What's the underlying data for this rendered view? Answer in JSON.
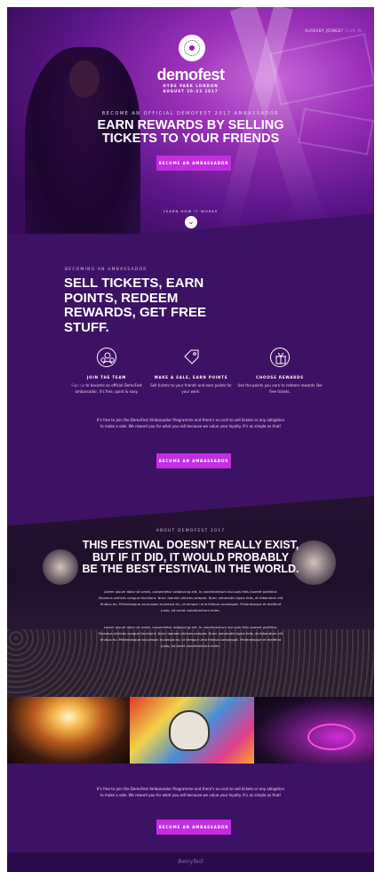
{
  "hero": {
    "signin_prefix": "ALREADY JOINED?",
    "signin_link": "SIGN IN",
    "brand": "demofest",
    "venue_line1": "HYDE PARK LONDON",
    "venue_line2": "AUGUST 20-23 2017",
    "eyebrow": "BECOME AN OFFICIAL DEMOFEST 2017 AMBASSADOR",
    "title_line1": "EARN REWARDS BY SELLING",
    "title_line2": "TICKETS TO YOUR FRIENDS",
    "cta": "BECOME AN AMBASSADOR",
    "learn": "LEARN HOW IT WORKS",
    "chevron": "⌄"
  },
  "ambassador": {
    "eyebrow": "BECOMING AN AMBASSADOR",
    "title": "SELL TICKETS, EARN POINTS, REDEEM REWARDS, GET FREE STUFF.",
    "features": [
      {
        "icon": "team-icon",
        "title": "JOIN THE TEAM",
        "highlight": "Sign up",
        "desc": " to become an official DemoFest ambassador, it's free, quick & easy."
      },
      {
        "icon": "tag-icon",
        "title": "MAKE A SALE, EARN POINTS",
        "highlight": "",
        "desc": "Sell tickets to your friends and earn points for your work."
      },
      {
        "icon": "gift-icon",
        "title": "CHOOSE REWARDS",
        "highlight": "",
        "desc": "Use the points you earn to redeem rewards like free tickets."
      }
    ],
    "paragraph": "It's free to join the DemoFest Ambassador Programme and there's no cost to sell tickets or any obligation to make a sale. We reward you for what you sell because we value your loyalty. It's as simple as that!",
    "cta": "BECOME AN AMBASSADOR"
  },
  "about": {
    "eyebrow": "ABOUT DEMOFEST 2017",
    "title_line1": "THIS FESTIVAL DOESN'T REALLY EXIST,",
    "title_line2": "BUT IF IT DID, IT WOULD PROBABLY",
    "title_line3": "BE THE BEST FESTIVAL IN THE WORLD.",
    "p1": "Lorem ipsum dolor sit amet, consectetur adipiscing elit. In condimentum dui quis felis laoreet porttitor. Vivamus ultrices congue tincidunt. Nunc laoreet ultrices semper. Nunc venenatis ligula felis, et bibendum elit finibus eu. Pellentesque accumsan euismod ex, ut tempor urna finibus consequat. Pellentesque et eleifend justo, sit amet condimentum enim.",
    "p2": "Lorem ipsum dolor sit amet, consectetur adipiscing elit. In condimentum dui quis felis laoreet porttitor. Vivamus ultrices congue tincidunt. Nunc laoreet ultrices semper. Nunc venenatis ligula felis, et bibendum elit finibus eu. Pellentesque accumsan euismod ex, ut tempor urna finibus consequat. Pellentesque et eleifend justo, sit amet condimentum enim."
  },
  "bottom": {
    "paragraph": "It's free to join the DemoFest Ambassador Programme and there's no cost to sell tickets or any obligation to make a sale. We reward you for what you sell because we value your loyalty. It's as simple as that!",
    "cta": "BECOME AN AMBASSADOR"
  },
  "footer": {
    "logo": "Bemyfest"
  },
  "colors": {
    "primary_bg": "#3d1163",
    "accent": "#c22ee0",
    "link": "#d36ff0"
  }
}
